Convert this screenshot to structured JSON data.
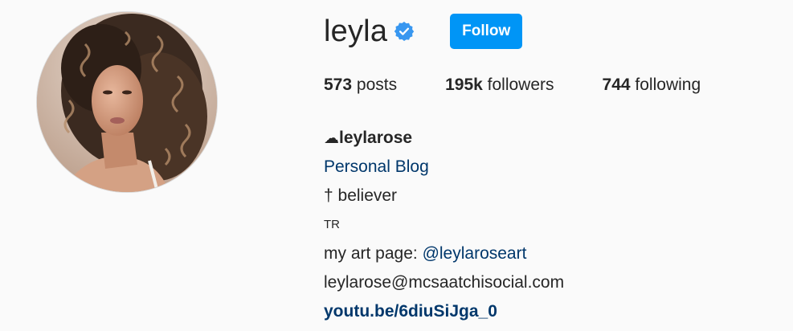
{
  "profile": {
    "username": "leyla",
    "follow_label": "Follow",
    "stats": {
      "posts_count": "573",
      "posts_label": "posts",
      "followers_count": "195k",
      "followers_label": "followers",
      "following_count": "744",
      "following_label": "following"
    },
    "bio": {
      "cloud_symbol": "☁",
      "full_name": "leylarose",
      "category": "Personal Blog",
      "line_believer": "† believer",
      "line_country": "TR",
      "art_prefix": "my art page: ",
      "art_handle": "@leylaroseart",
      "email": "leylarose@mcsaatchisocial.com",
      "website": "youtu.be/6diuSiJga_0"
    }
  },
  "colors": {
    "accent": "#0095f6",
    "link": "#00376b",
    "verified": "#3897f0",
    "background": "#fafafa",
    "text": "#262626"
  },
  "icons": {
    "verified": "verified-badge-icon"
  }
}
